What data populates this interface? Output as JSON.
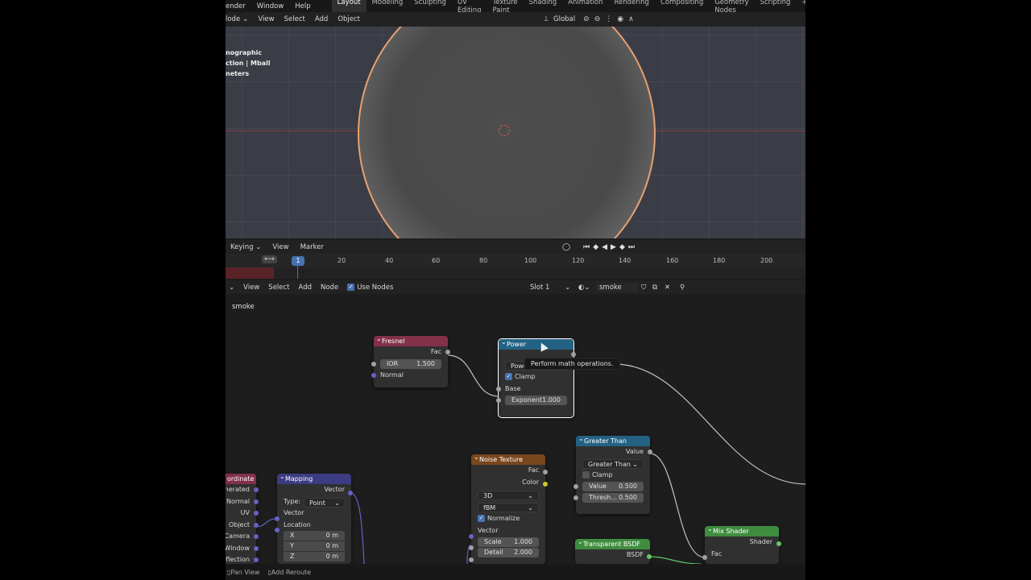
{
  "topbar": {
    "menus": [
      "ender",
      "Window",
      "Help"
    ],
    "workspaces": [
      "Layout",
      "Modeling",
      "Sculpting",
      "UV Editing",
      "Texture Paint",
      "Shading",
      "Animation",
      "Rendering",
      "Compositing",
      "Geometry Nodes",
      "Scripting"
    ],
    "active_workspace": "Layout",
    "add_tab": "+"
  },
  "viewport": {
    "mode_label": "lode",
    "menus": [
      "View",
      "Select",
      "Add",
      "Object"
    ],
    "orientation": "Global",
    "info_lines": [
      "nographic",
      "ction | Mball",
      "neters"
    ]
  },
  "timeline": {
    "menus": [
      "Keying",
      "View",
      "Marker"
    ],
    "current_frame": "1",
    "ticks": [
      "20",
      "40",
      "60",
      "80",
      "100",
      "120",
      "140",
      "160",
      "180",
      "200"
    ]
  },
  "node_editor": {
    "menus": [
      "View",
      "Select",
      "Add",
      "Node"
    ],
    "use_nodes_label": "Use Nodes",
    "slot": "Slot 1",
    "material_name": "smoke",
    "breadcrumb": "smoke",
    "footer": [
      "Pan View",
      "Add Reroute"
    ]
  },
  "tooltip": "Perform math operations.",
  "nodes": {
    "fresnel": {
      "title": "Fresnel",
      "out_fac": "Fac",
      "ior_label": "IOR",
      "ior_value": "1.500",
      "normal": "Normal"
    },
    "power": {
      "title": "Power",
      "op": "Power",
      "clamp": "Clamp",
      "base": "Base",
      "exp_label": "Exponent",
      "exp_value": "1.000"
    },
    "greater": {
      "title": "Greater Than",
      "out_value": "Value",
      "op": "Greater Than",
      "clamp": "Clamp",
      "value_label": "Value",
      "value_value": "0.500",
      "thresh_label": "Thresh...",
      "thresh_value": "0.500"
    },
    "texcoord": {
      "title": "ordinate",
      "outputs": [
        "enerated",
        "Normal",
        "UV",
        "Object",
        "Camera",
        "Window",
        "eflection"
      ]
    },
    "mapping": {
      "title": "Mapping",
      "out_vector": "Vector",
      "type_label": "Type:",
      "type_value": "Point",
      "in_vector": "Vector",
      "location": "Location",
      "x": "X",
      "x_val": "0 m",
      "y": "Y",
      "y_val": "0 m",
      "z": "Z",
      "z_val": "0 m"
    },
    "noise": {
      "title": "Noise Texture",
      "fac": "Fac",
      "color": "Color",
      "dim": "3D",
      "type": "fBM",
      "normalize": "Normalize",
      "vector": "Vector",
      "scale_label": "Scale",
      "scale_value": "1.000",
      "detail_label": "Detail",
      "detail_value": "2.000"
    },
    "transparent": {
      "title": "Transparent BSDF",
      "out": "BSDF"
    },
    "mix": {
      "title": "Mix Shader",
      "out": "Shader",
      "fac": "Fac"
    }
  },
  "colors": {
    "input_header": "#83314a",
    "converter_header": "#246283",
    "texture_header": "#79461d",
    "vector_header": "#3c3c83",
    "shader_header": "#3f8c3f",
    "accent": "#4772b3"
  }
}
